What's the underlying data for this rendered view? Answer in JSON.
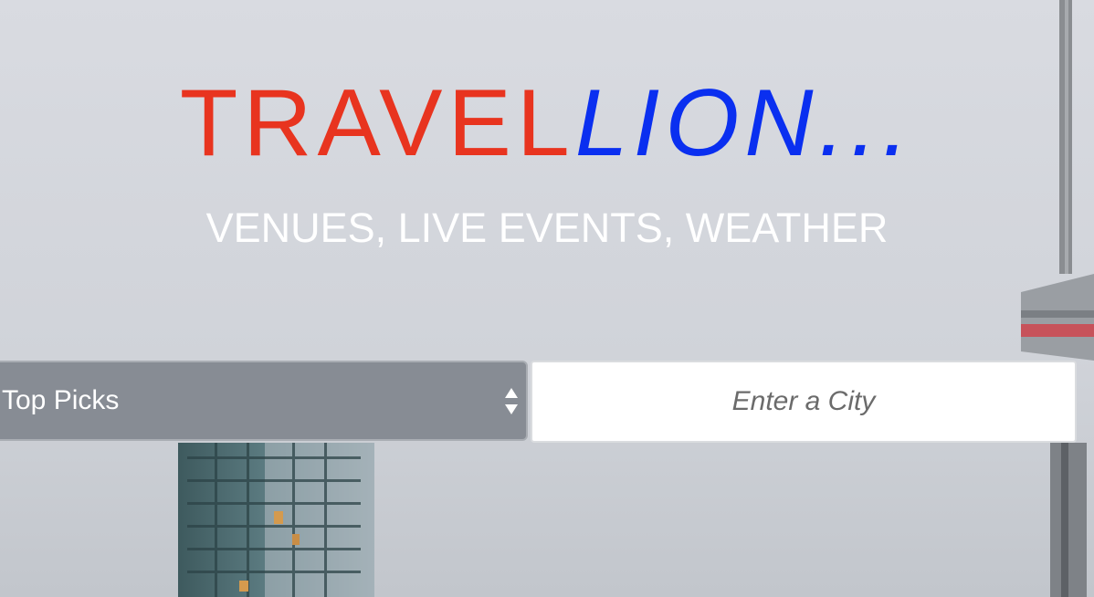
{
  "brand": {
    "part1": "TRAVEL",
    "part2": "LION...",
    "part1_color": "#e8341f",
    "part2_color": "#0a2ff0"
  },
  "tagline": "VENUES, LIVE EVENTS, WEATHER",
  "search": {
    "category_selected": "Top Picks",
    "city_placeholder": "Enter a City",
    "city_value": ""
  },
  "icons": {
    "select_arrows": "up-down-arrows-icon"
  }
}
